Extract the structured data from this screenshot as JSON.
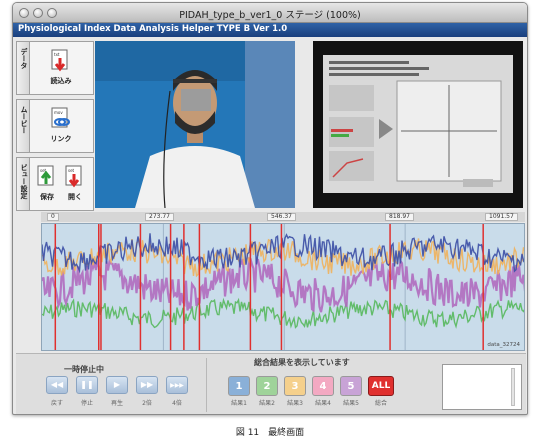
{
  "window": {
    "title": "PIDAH_type_b_ver1_0 ステージ (100%)"
  },
  "app": {
    "title": "Physiological Index Data Analysis Helper TYPE B Ver 1.0"
  },
  "toolbar": {
    "sections": [
      {
        "tab": "データ",
        "buttons": [
          {
            "label": "読込み",
            "icon": "load-file-icon"
          }
        ]
      },
      {
        "tab": "ムービー",
        "buttons": [
          {
            "label": "リンク",
            "icon": "link-file-icon"
          }
        ]
      },
      {
        "tab": "ビュー設定",
        "buttons": [
          {
            "label": "保存",
            "icon": "save-file-icon"
          },
          {
            "label": "開く",
            "icon": "open-file-icon"
          }
        ]
      }
    ]
  },
  "timeline": {
    "ticks": [
      "0",
      "273.77",
      "546.37",
      "818.97",
      "1091.57"
    ]
  },
  "chart_data": {
    "type": "line",
    "xlim": [
      0,
      1091.57
    ],
    "x_ticks": [
      0,
      273.77,
      546.37,
      818.97,
      1091.57
    ],
    "series": [
      {
        "color": "#3b4ea5",
        "level": 0.78
      },
      {
        "color": "#f0b15c",
        "level": 0.74
      },
      {
        "color": "#b06cbf",
        "level": 0.52
      },
      {
        "color": "#57b85d",
        "level": 0.3
      }
    ],
    "marker_color": "#e0302f",
    "markers": [
      30,
      128,
      133,
      222,
      290,
      320,
      355,
      470,
      540,
      785,
      995
    ],
    "label": "data_32724"
  },
  "controls": {
    "status": "一時停止中",
    "buttons": [
      {
        "label": "戻す",
        "icon": "rewind-icon"
      },
      {
        "label": "停止",
        "icon": "pause-icon"
      },
      {
        "label": "再生",
        "icon": "play-icon"
      },
      {
        "label": "2倍",
        "icon": "fast-forward-icon"
      },
      {
        "label": "4倍",
        "icon": "faster-forward-icon"
      }
    ]
  },
  "results": {
    "heading": "総合結果を表示しています",
    "buttons": [
      {
        "num": "1",
        "label": "結果1",
        "color": "#8ab0d8"
      },
      {
        "num": "2",
        "label": "結果2",
        "color": "#9fd39a"
      },
      {
        "num": "3",
        "label": "結果3",
        "color": "#f5d08c"
      },
      {
        "num": "4",
        "label": "結果4",
        "color": "#f3a9c2"
      },
      {
        "num": "5",
        "label": "結果5",
        "color": "#c8a3d6"
      }
    ],
    "all_label": "ALL",
    "all_caption": "総合",
    "all_color": "#e0302f"
  },
  "caption": "図 11　最終画面"
}
